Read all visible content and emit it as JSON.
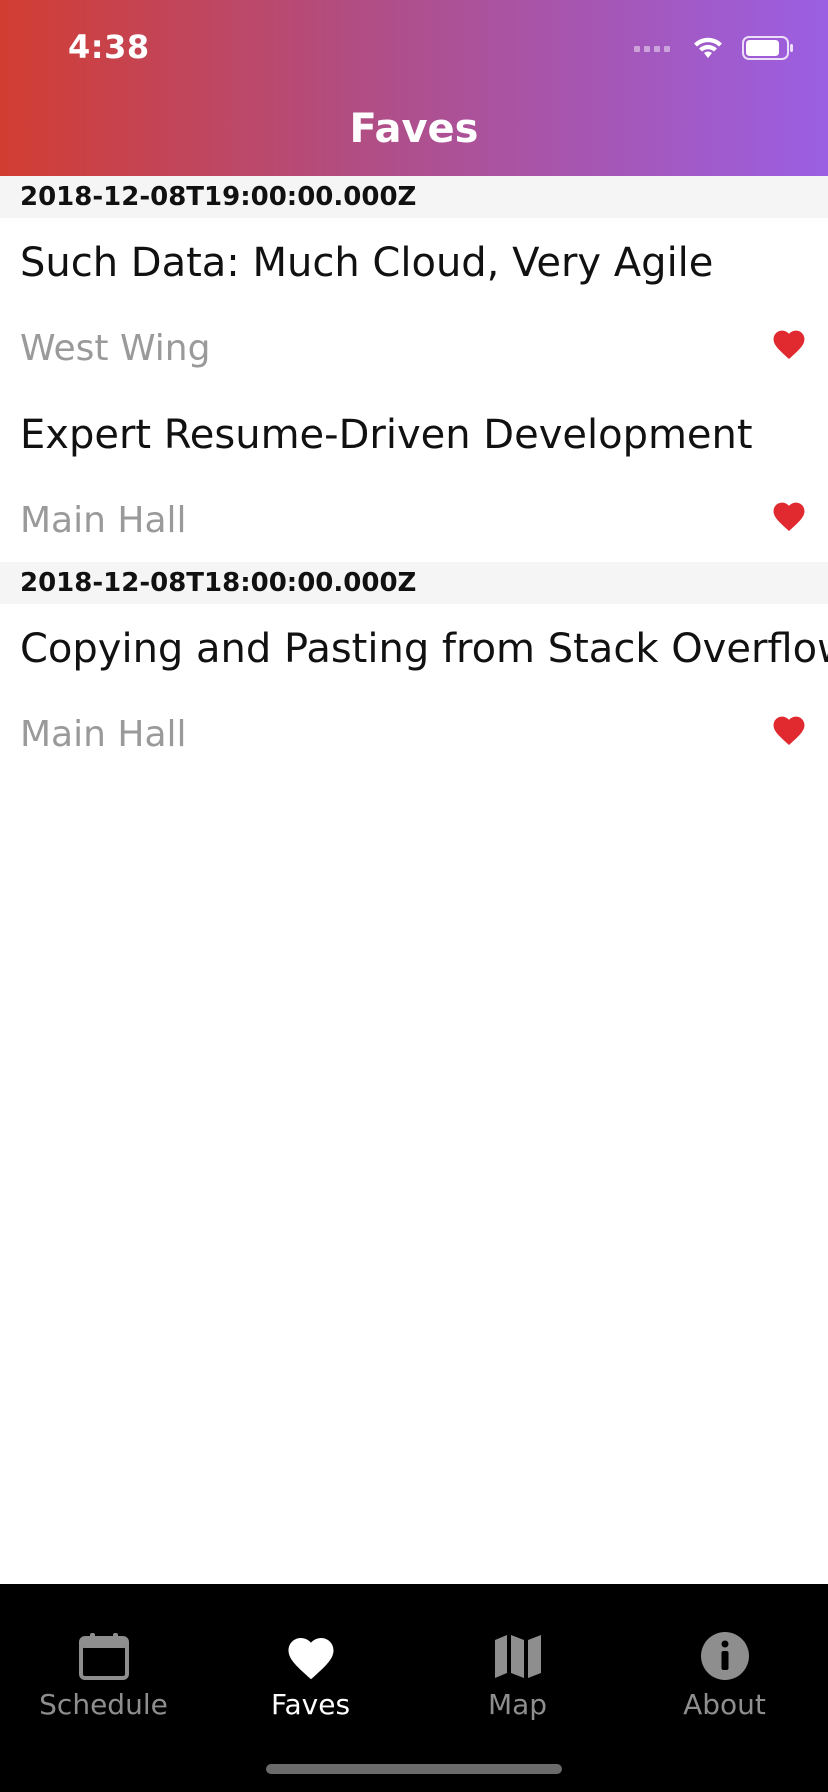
{
  "status_bar": {
    "time": "4:38"
  },
  "header": {
    "title": "Faves"
  },
  "sections": [
    {
      "header": "2018-12-08T19:00:00.000Z",
      "items": [
        {
          "title": "Such Data: Much Cloud, Very Agile",
          "room": "West Wing",
          "favorited": true
        },
        {
          "title": "Expert Resume-Driven Development",
          "room": "Main Hall",
          "favorited": true
        }
      ]
    },
    {
      "header": "2018-12-08T18:00:00.000Z",
      "items": [
        {
          "title": "Copying and Pasting from Stack Overflow",
          "room": "Main Hall",
          "favorited": true
        }
      ]
    }
  ],
  "tabs": [
    {
      "label": "Schedule",
      "icon": "calendar-icon",
      "active": false
    },
    {
      "label": "Faves",
      "icon": "heart-icon",
      "active": true
    },
    {
      "label": "Map",
      "icon": "map-icon",
      "active": false
    },
    {
      "label": "About",
      "icon": "info-icon",
      "active": false
    }
  ],
  "colors": {
    "gradient_start": "#d23d32",
    "gradient_end": "#9b5fe3",
    "heart": "#e12a2f",
    "tab_active": "#ffffff",
    "tab_inactive": "#8e8e8e"
  }
}
